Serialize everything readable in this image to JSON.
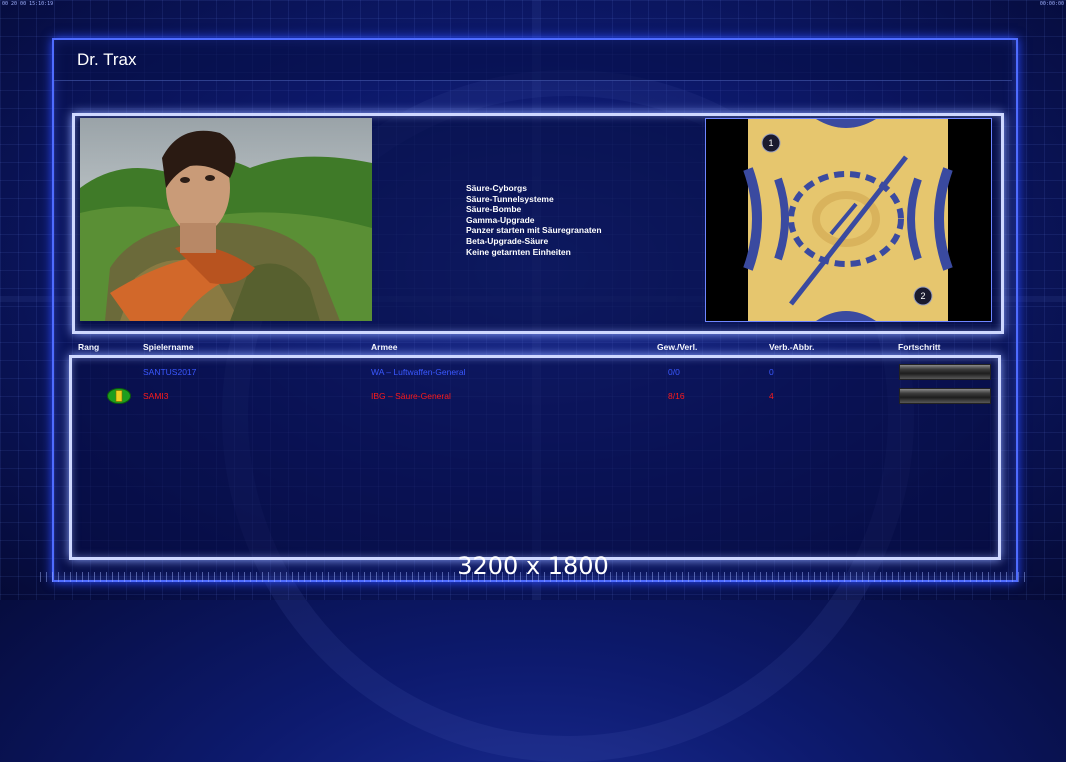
{
  "topbar": {
    "left": "00 20 00 15:10:19",
    "right": "00:00:00"
  },
  "player": {
    "name": "Dr. Trax"
  },
  "upgrades": [
    "Säure-Cyborgs",
    "Säure-Tunnelsysteme",
    "Säure-Bombe",
    "Gamma-Upgrade",
    "Panzer starten mit Säuregranaten",
    "Beta-Upgrade-Säure",
    "Keine getarnten Einheiten"
  ],
  "table": {
    "headers": {
      "rank": "Rang",
      "player_name": "Spielername",
      "army": "Armee",
      "wins_losses": "Gew./Verl.",
      "disconnects": "Verb.-Abbr.",
      "progress": "Fortschritt"
    },
    "rows": [
      {
        "name": "SANTUS2017",
        "army": "WA – Luftwaffen-General",
        "wins_losses": "0/0",
        "disconnects": "0",
        "color": "#3a58ff",
        "has_rank_icon": false,
        "progress": 0
      },
      {
        "name": "SAMI3",
        "army": "IBG – Säure-General",
        "wins_losses": "8/16",
        "disconnects": "4",
        "color": "#ff1a1a",
        "has_rank_icon": true,
        "progress": 0
      }
    ]
  },
  "minimap": {
    "start_positions": [
      "1",
      "2"
    ]
  },
  "overlay": {
    "resolution": "3200 x 1800"
  }
}
